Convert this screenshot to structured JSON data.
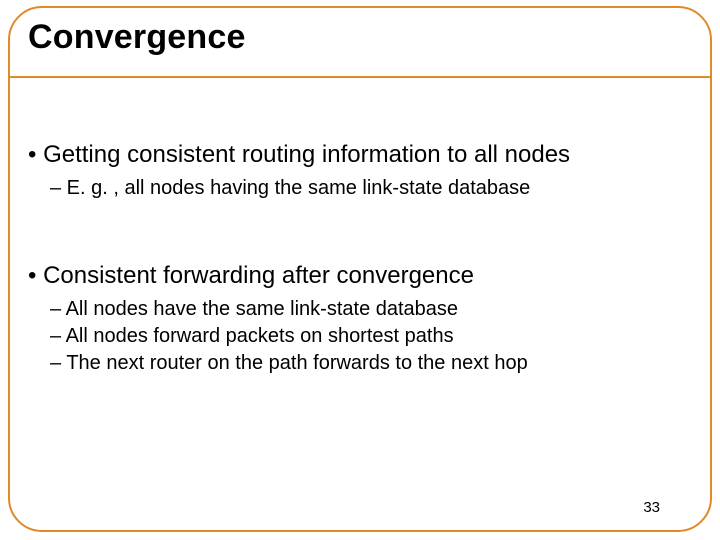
{
  "title": "Convergence",
  "body": {
    "b1": "• Getting consistent routing information to all nodes",
    "b1s1": "– E. g. , all nodes having the same link-state database",
    "b2": "• Consistent forwarding after convergence",
    "b2s1": "– All nodes have the same link-state database",
    "b2s2": "– All nodes forward packets on shortest paths",
    "b2s3": "– The next router on the path forwards to the next hop"
  },
  "page_number": "33"
}
